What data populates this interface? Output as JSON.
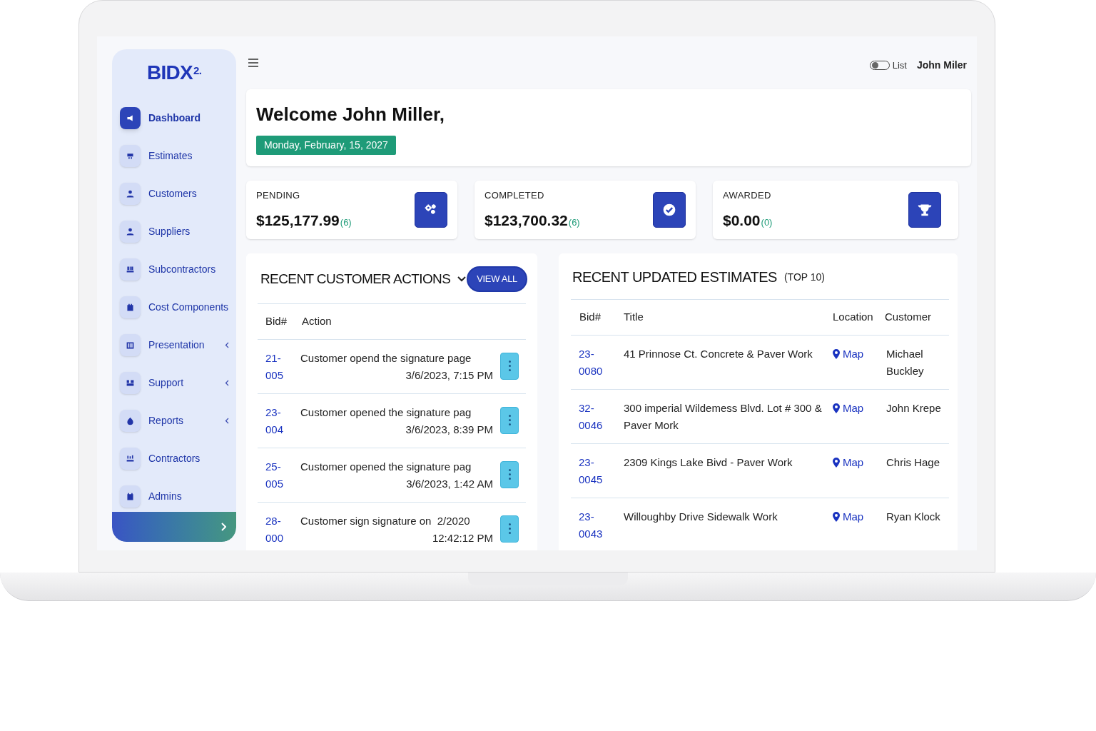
{
  "brand": {
    "name": "BIDX",
    "superscript": "2."
  },
  "sidebar": {
    "items": [
      {
        "label": "Dashboard",
        "selected": true,
        "has_submenu": false
      },
      {
        "label": "Estimates",
        "selected": false,
        "has_submenu": false
      },
      {
        "label": "Customers",
        "selected": false,
        "has_submenu": false
      },
      {
        "label": "Suppliers",
        "selected": false,
        "has_submenu": false
      },
      {
        "label": "Subcontractors",
        "selected": false,
        "has_submenu": false
      },
      {
        "label": "Cost Components",
        "selected": false,
        "has_submenu": false
      },
      {
        "label": "Presentation",
        "selected": false,
        "has_submenu": true
      },
      {
        "label": "Support",
        "selected": false,
        "has_submenu": true
      },
      {
        "label": "Reports",
        "selected": false,
        "has_submenu": true
      },
      {
        "label": "Contractors",
        "selected": false,
        "has_submenu": false
      },
      {
        "label": "Admins",
        "selected": false,
        "has_submenu": false
      }
    ]
  },
  "header": {
    "view_toggle": {
      "label": "List",
      "on": false
    },
    "user": "John Miler"
  },
  "welcome": {
    "title": "Welcome John Miller,",
    "date": "Monday, February, 15, 2027"
  },
  "stats": [
    {
      "label": "PENDING",
      "amount": "$125,177.99",
      "count": "(6)"
    },
    {
      "label": "COMPLETED",
      "amount": "$123,700.32",
      "count": "(6)"
    },
    {
      "label": "AWARDED",
      "amount": "$0.00",
      "count": "(0)"
    }
  ],
  "customer_actions": {
    "title": "RECENT CUSTOMER ACTIONS",
    "button": "VIEW ALL",
    "columns": [
      "Bid#",
      "Action"
    ],
    "rows": [
      {
        "bid": "21-005",
        "action": "Customer opend the signature page",
        "time": "3/6/2023, 7:15 PM"
      },
      {
        "bid": "23-004",
        "action": "Customer opened the signature pag",
        "time": "3/6/2023, 8:39 PM"
      },
      {
        "bid": "25-005",
        "action": "Customer opened the signature pag",
        "time": "3/6/2023, 1:42 AM"
      },
      {
        "bid": "28-000",
        "action": "Customer sign signature on  2/2020",
        "time": "12:42:12 PM"
      }
    ]
  },
  "estimates": {
    "title": "RECENT UPDATED ESTIMATES",
    "subtitle": "(TOP 10)",
    "columns": [
      "Bid#",
      "Title",
      "Location",
      "Customer"
    ],
    "rows": [
      {
        "bid": "23-0080",
        "title": "41 Prinnose Ct. Concrete & Paver Work",
        "location": "Map",
        "customer": "Michael Buckley"
      },
      {
        "bid": "32-0046",
        "title": "300 imperial Wildemess Blvd. Lot # 300 & Paver Mork",
        "location": "Map",
        "customer": "John Krepe"
      },
      {
        "bid": "23-0045",
        "title": "2309 Kings Lake Bivd - Paver Work",
        "location": "Map",
        "customer": "Chris Hage"
      },
      {
        "bid": "23-0043",
        "title": "Willoughby Drive Sidewalk Work",
        "location": "Map",
        "customer": "Ryan Klock"
      }
    ]
  }
}
